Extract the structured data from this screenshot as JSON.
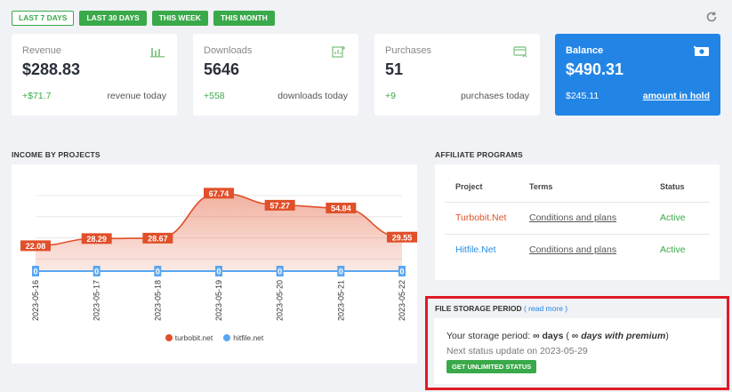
{
  "filters": [
    "LAST 7 DAYS",
    "LAST 30 DAYS",
    "THIS WEEK",
    "THIS MONTH"
  ],
  "colors": {
    "green": "#3aa94a",
    "blue": "#2285e6",
    "orange": "#e0502a",
    "hitfile_blue": "#5aa6f0",
    "highlight": "#e01a26"
  },
  "cards": {
    "revenue": {
      "label": "Revenue",
      "value": "$288.83",
      "delta": "+$71.7",
      "sub": "revenue today",
      "icon": "bar-chart-icon"
    },
    "downloads": {
      "label": "Downloads",
      "value": "5646",
      "delta": "+558",
      "sub": "downloads today",
      "icon": "chart-add-icon"
    },
    "purchases": {
      "label": "Purchases",
      "value": "51",
      "delta": "+9",
      "sub": "purchases today",
      "icon": "credit-card-icon"
    },
    "balance": {
      "label": "Balance",
      "value": "$490.31",
      "delta": "$245.11",
      "sub": "amount in hold",
      "icon": "money-icon"
    }
  },
  "income": {
    "title": "INCOME BY PROJECTS",
    "legend": [
      "turbobit.net",
      "hitfile.net"
    ]
  },
  "chart_data": {
    "type": "area",
    "title": "INCOME BY PROJECTS",
    "x": [
      "2023-05-16",
      "2023-05-17",
      "2023-05-18",
      "2023-05-19",
      "2023-05-20",
      "2023-05-21",
      "2023-05-22"
    ],
    "series": [
      {
        "name": "turbobit.net",
        "values": [
          22.08,
          28.29,
          28.67,
          67.74,
          57.27,
          54.84,
          29.55
        ],
        "labels": [
          "22.08",
          "28.29",
          "28.67",
          "67.74",
          "57.27",
          "54.84",
          "29.55"
        ]
      },
      {
        "name": "hitfile.net",
        "values": [
          0,
          0,
          0,
          0,
          0,
          0,
          0
        ],
        "labels": [
          "0",
          "0",
          "0",
          "0",
          "0",
          "0",
          "0"
        ]
      }
    ],
    "ylim": [
      0,
      85
    ],
    "grid": true,
    "legend": "bottom"
  },
  "affiliate": {
    "title": "AFFILIATE PROGRAMS",
    "headers": [
      "Project",
      "Terms",
      "Status"
    ],
    "rows": [
      {
        "project": "Turbobit.Net",
        "terms": "Conditions and plans",
        "status": "Active"
      },
      {
        "project": "Hitfile.Net",
        "terms": "Conditions and plans",
        "status": "Active"
      }
    ]
  },
  "storage": {
    "title": "FILE STORAGE PERIOD",
    "read_more": "( read more )",
    "line_prefix": "Your storage period: ",
    "days_symbol": "∞ days",
    "paren_open": " ( ",
    "premium_text": "∞ days with premium",
    "paren_close": ")",
    "next_update": "Next status update on 2023-05-29",
    "button": "GET UNLIMITED STATUS"
  }
}
